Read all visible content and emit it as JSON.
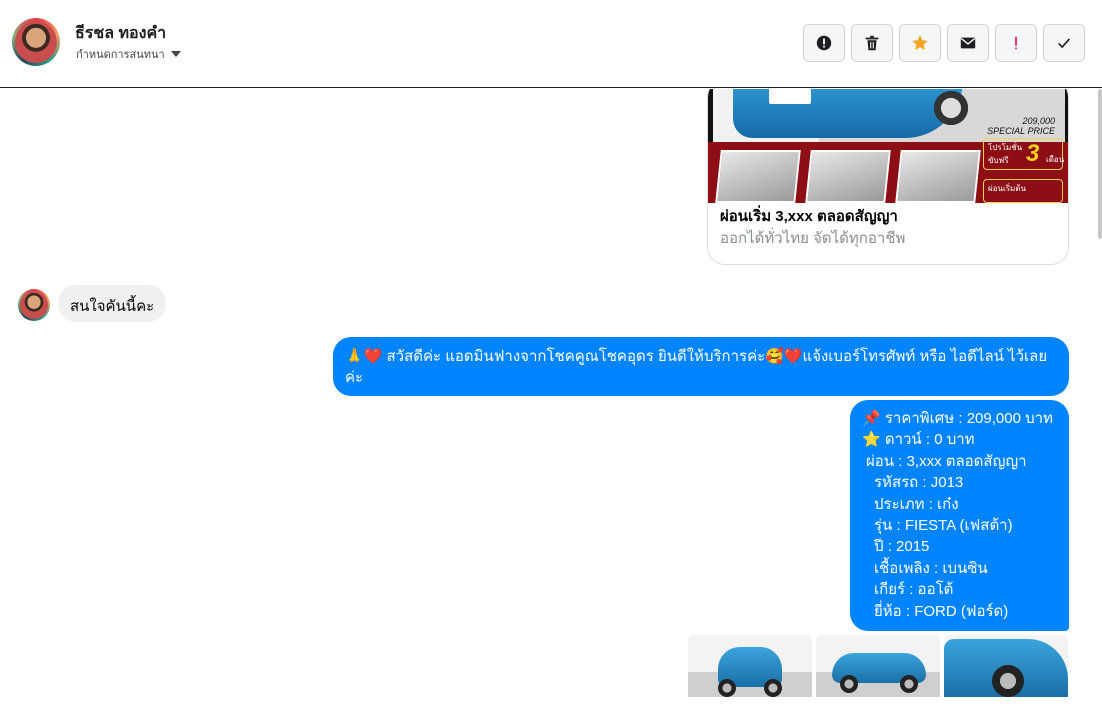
{
  "header": {
    "contact_name": "ธีรชล ทองคำ",
    "subtitle": "กำหนดการสนทนา"
  },
  "toolbar": {
    "buttons": [
      {
        "icon": "alert-circle-icon"
      },
      {
        "icon": "trash-icon"
      },
      {
        "icon": "star-icon",
        "color": "#f5a623"
      },
      {
        "icon": "mail-icon"
      },
      {
        "icon": "important-icon",
        "color": "#e0245e"
      },
      {
        "icon": "check-icon"
      }
    ]
  },
  "ad_card": {
    "price_line1": "209,000",
    "price_line2": "SPECIAL PRICE",
    "promo_small": "โปรโมชั่น",
    "promo_sub": "ขับฟรี",
    "promo_big": "3",
    "promo_unit": "เดือน",
    "promo2": "ผ่อนเริ่มต้น",
    "title": "ผ่อนเริ่ม 3,xxx ตลอดสัญญา",
    "description": "ออกได้ทั่วไทย จัดได้ทุกอาชีพ"
  },
  "messages": {
    "incoming": "สนใจคันนี้คะ",
    "outgoing1": "🙏❤️ สวัสดีค่ะ แอดมินฟางจากโชคคูณโชคอุดร ยินดีให้บริการค่ะ🥰❤️แจ้งเบอร์โทรศัพท์ หรือ ไอดีไลน์  ไว้เลยค่ะ",
    "outgoing2": {
      "price": "📌 ราคาพิเศษ : 209,000 บาท",
      "down": "⭐ ดาวน์ : 0 บาท",
      "installment": "ผ่อน : 3,xxx ตลอดสัญญา",
      "code": "รหัสรถ : J013",
      "type": "ประเภท : เก๋ง",
      "model": "รุ่น : FIESTA (เฟสต้า)",
      "year": "ปี : 2015",
      "fuel": "เชื้อเพลิง : เบนซิน",
      "gear": "เกียร์ : ออโต้",
      "brand": "ยี่ห้อ : FORD (ฟอร์ด)"
    }
  },
  "colors": {
    "outgoing_bubble": "#0084ff",
    "incoming_bubble": "#f0f0f0",
    "star": "#f5a623",
    "important": "#e0245e"
  }
}
